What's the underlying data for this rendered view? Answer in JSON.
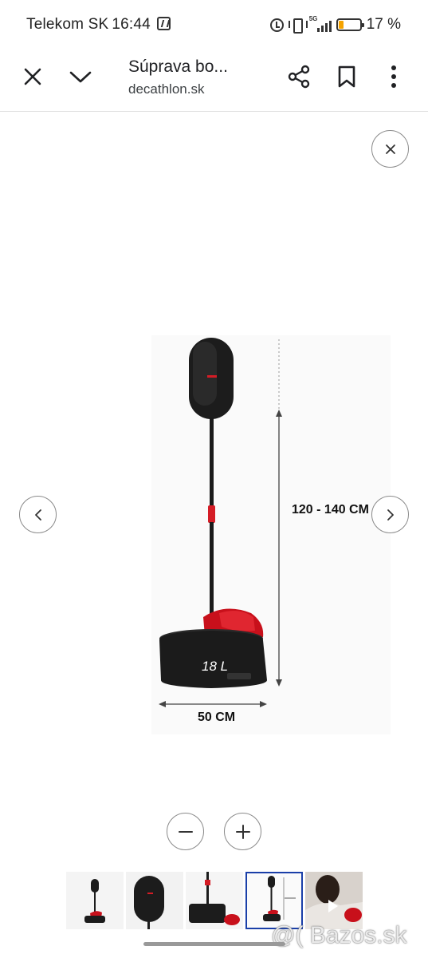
{
  "status_bar": {
    "carrier": "Telekom SK",
    "time": "16:44",
    "network": "5G",
    "battery": "17 %",
    "battery_level": 0.17
  },
  "toolbar": {
    "title": "Súprava bo...",
    "url": "decathlon.sk",
    "icons": [
      "close-icon",
      "chevron-down-icon",
      "share-icon",
      "bookmark-icon",
      "more-vert-icon"
    ]
  },
  "image_viewer": {
    "height_label": "120 - 140 CM",
    "width_label": "50 CM",
    "tank_label": "18 L",
    "controls": [
      "close-icon",
      "chevron-left-icon",
      "chevron-right-icon",
      "zoom-out-icon",
      "zoom-in-icon"
    ]
  },
  "thumbnails": {
    "count": 5,
    "selected_index": 3
  },
  "watermark": "@( Bazos.sk"
}
